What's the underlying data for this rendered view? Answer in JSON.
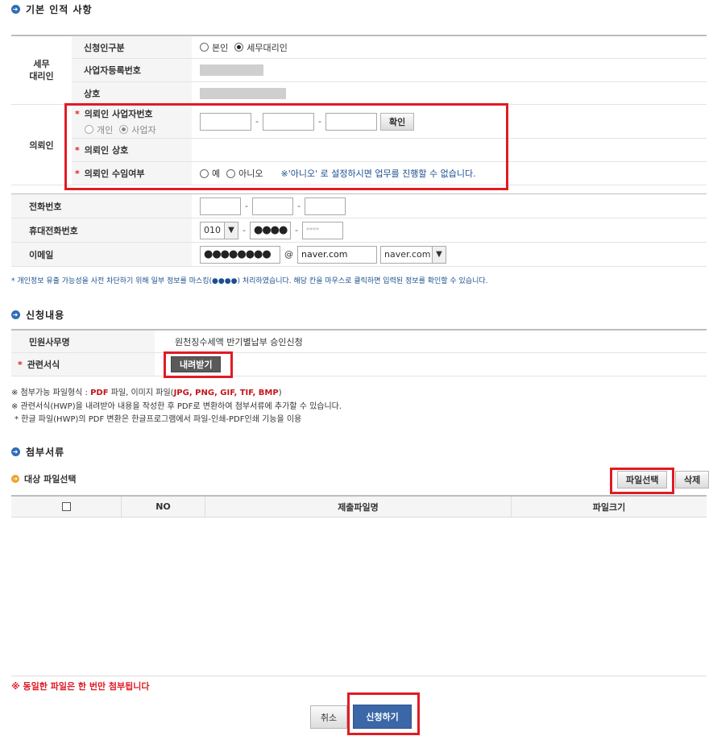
{
  "section_basic": {
    "title": "기본 인적 사항"
  },
  "agent": {
    "group_label": "세무\n대리인",
    "applicant_type_label": "신청인구분",
    "opt_self": "본인",
    "opt_agent": "세무대리인",
    "bizno_label": "사업자등록번호",
    "name_label": "상호"
  },
  "client": {
    "group_label": "의뢰인",
    "bizno_label": "의뢰인 사업자번호",
    "opt_personal": "개인",
    "opt_business": "사업자",
    "confirm_btn": "확인",
    "name_label": "의뢰인 상호",
    "consent_label": "의뢰인 수임여부",
    "opt_yes": "예",
    "opt_no": "아니오",
    "consent_note": "※'아니오' 로 설정하시면 업무를 진행할 수 없습니다."
  },
  "contact": {
    "phone_label": "전화번호",
    "mobile_label": "휴대전화번호",
    "mobile_prefix": "010",
    "mobile_mid": "●●●●",
    "mobile_last": "****",
    "email_label": "이메일",
    "email_id": "●●●●●●●●",
    "email_at": "@",
    "email_domain": "naver.com",
    "email_select": "naver.com"
  },
  "privacy_note": "* 개인정보 유출 가능성을 사전 차단하기 위해 일부 정보를 마스킹(●●●●) 처리하였습니다. 해당 칸을 마우스로 클릭하면 입력된 정보를 확인할 수 있습니다.",
  "section_request": {
    "title": "신청내용"
  },
  "request": {
    "service_label": "민원사무명",
    "service_value": "원천징수세액 반기별납부 승인신청",
    "form_label": "관련서식",
    "download_btn": "내려받기"
  },
  "notes": {
    "line1_prefix": "※ 첨부가능 파일형식 : ",
    "line1_pdf": "PDF",
    "line1_mid": " 파일, 이미지 파일(",
    "line1_img": "JPG, PNG, GIF, TIF, BMP",
    "line1_end": ")",
    "line2": "※ 관련서식(HWP)을 내려받아 내용을 작성한 후 PDF로 변환하여 첨부서류에 추가할 수 있습니다.",
    "line3": "* 한글 파일(HWP)의 PDF 변환은 한글프로그램에서 파일-인쇄-PDF인쇄 기능을 이용"
  },
  "section_attach": {
    "title": "첨부서류"
  },
  "attach": {
    "subtitle": "대상 파일선택",
    "select_btn": "파일선택",
    "delete_btn": "삭제",
    "col_no": "NO",
    "col_name": "제출파일명",
    "col_size": "파일크기"
  },
  "warning": "※ 동일한 파일은 한 번만 첨부됩니다",
  "footer": {
    "cancel": "취소",
    "submit": "신청하기"
  },
  "colors": {
    "accent": "#2f6db5",
    "highlight": "#e01b24",
    "submit": "#3b67a8"
  }
}
